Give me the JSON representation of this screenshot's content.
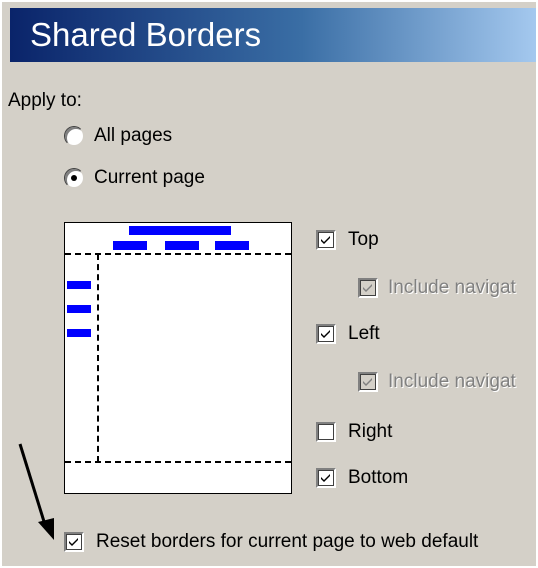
{
  "dialog": {
    "title": "Shared Borders"
  },
  "apply_to": {
    "label": "Apply to:",
    "options": [
      {
        "label": "All pages",
        "selected": false
      },
      {
        "label": "Current page",
        "selected": true
      }
    ]
  },
  "borders": {
    "top": {
      "label": "Top",
      "checked": true
    },
    "top_nav": {
      "label": "Include navigat",
      "checked": true,
      "enabled": false
    },
    "left": {
      "label": "Left",
      "checked": true
    },
    "left_nav": {
      "label": "Include navigat",
      "checked": true,
      "enabled": false
    },
    "right": {
      "label": "Right",
      "checked": false
    },
    "bottom": {
      "label": "Bottom",
      "checked": true
    }
  },
  "reset": {
    "label": "Reset borders for current page to web default",
    "checked": true
  },
  "colors": {
    "preview_bars": "#0000ff",
    "title_gradient_start": "#0a246a",
    "title_gradient_end": "#a6caf0"
  }
}
